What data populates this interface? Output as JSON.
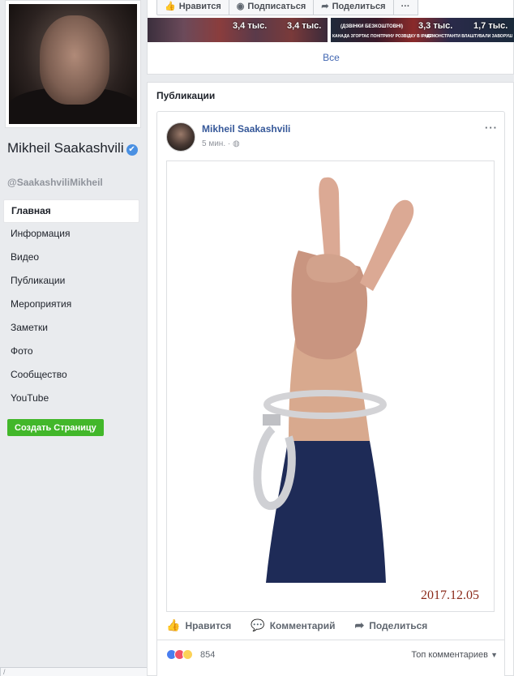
{
  "profile": {
    "name": "Mikheil Saakashvili",
    "handle": "@SaakashviliMikheil",
    "verified_badge": "✔"
  },
  "nav": {
    "items": [
      {
        "label": "Главная",
        "active": true
      },
      {
        "label": "Информация"
      },
      {
        "label": "Видео"
      },
      {
        "label": "Публикации"
      },
      {
        "label": "Мероприятия"
      },
      {
        "label": "Заметки"
      },
      {
        "label": "Фото"
      },
      {
        "label": "Сообщество"
      },
      {
        "label": "YouTube"
      }
    ],
    "create_page_label": "Создать Страницу"
  },
  "header_actions": {
    "like": "Нравится",
    "follow": "Подписаться",
    "share": "Поделиться",
    "more": "···"
  },
  "videos": {
    "thumb1_views_a": "3,4 тыс.",
    "thumb1_views_b": "3,4 тыс.",
    "thumb2_caption": "(ДЗВІНКИ БЕЗКОШТОВНІ)",
    "thumb2_caption_b": "КАНАДА ЗГОРТАЄ ПОНІТРИНУ РОЗВІДКУ В ІРАК?",
    "thumb2_views_a": "3,3 тыс.",
    "thumb2_views_b": "1,7 тыс.",
    "thumb2_caption_c": "ДЕМОНСТРАНТИ ВЛАШТУВАЛИ ЗАВОРУШ",
    "all_label": "Все"
  },
  "publications": {
    "title": "Публикации",
    "post": {
      "author": "Mikheil Saakashvili",
      "time": "5 мин.",
      "menu": "···",
      "image_date": "2017.12.05",
      "actions": {
        "like": "Нравится",
        "comment": "Комментарий",
        "share": "Поделиться"
      },
      "reaction_count": "854",
      "top_comments": "Топ комментариев"
    }
  },
  "status_bar": {
    "text": "/"
  },
  "colors": {
    "link": "#365899",
    "green": "#42b72a",
    "background": "#e9ebee",
    "date": "#8b2a1a"
  }
}
